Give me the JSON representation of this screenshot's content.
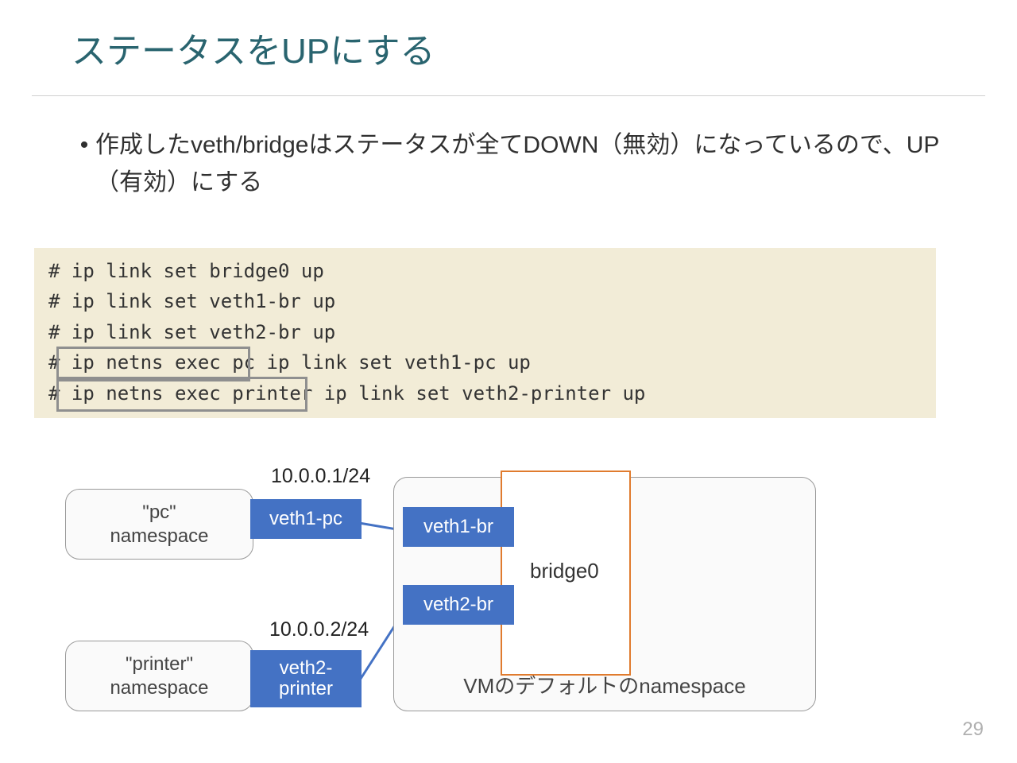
{
  "title": "ステータスをUPにする",
  "bullet": "作成したveth/bridgeはステータスが全てDOWN（無効）になっているので、UP（有効）にする",
  "code": {
    "l1": "# ip link set bridge0 up",
    "l2": "# ip link set veth1-br up",
    "l3": "# ip link set veth2-br up",
    "l4": "# ip netns exec pc ip link set veth1-pc up",
    "l5": "# ip netns exec printer ip link set veth2-printer up"
  },
  "diagram": {
    "pc_ns_1": "\"pc\"",
    "pc_ns_2": "namespace",
    "printer_ns_1": "\"printer\"",
    "printer_ns_2": "namespace",
    "vm_ns": "VMのデフォルトのnamespace",
    "bridge": "bridge0",
    "veth1_pc": "veth1-pc",
    "veth1_br": "veth1-br",
    "veth2_br": "veth2-br",
    "veth2_printer_1": "veth2-",
    "veth2_printer_2": "printer",
    "ip1": "10.0.0.1/24",
    "ip2": "10.0.0.2/24"
  },
  "page": "29"
}
